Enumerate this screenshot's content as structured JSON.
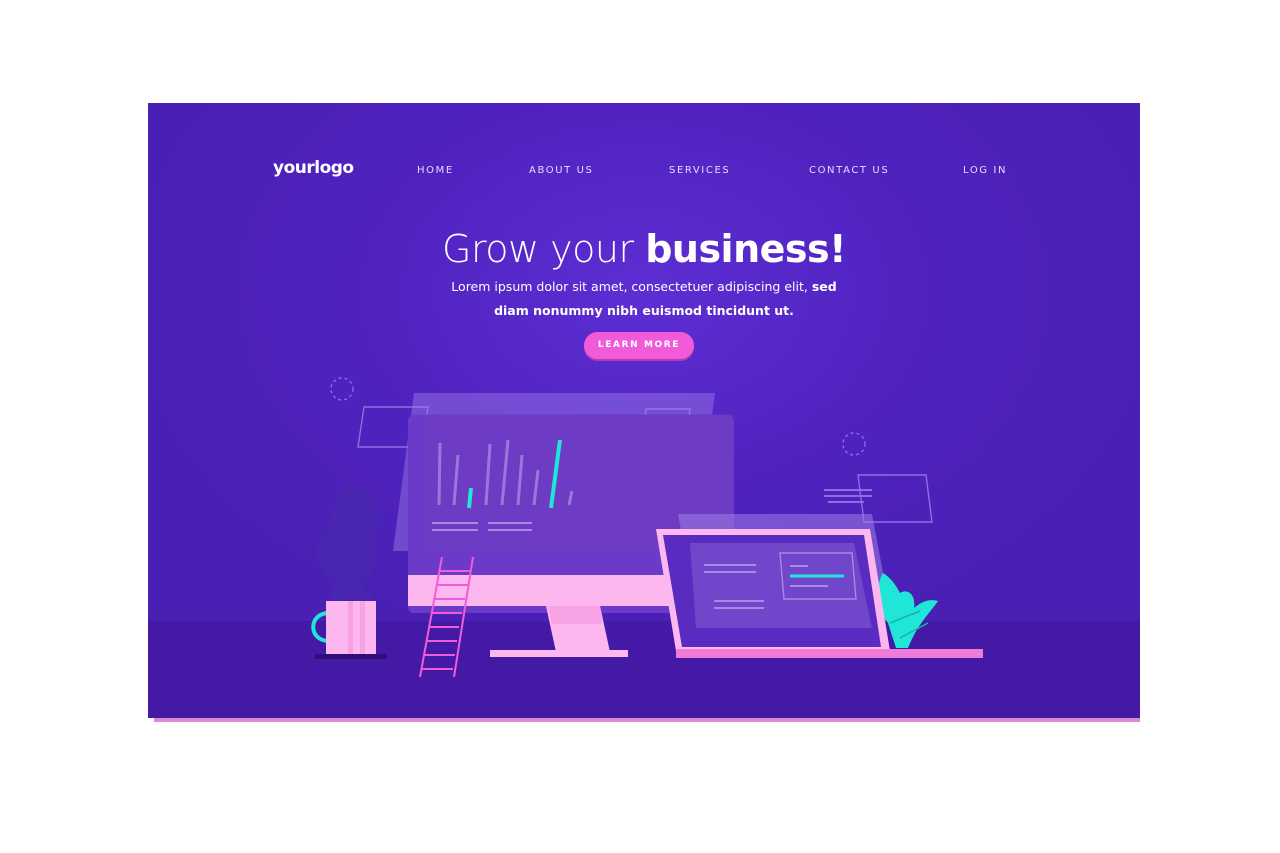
{
  "brand": {
    "logo": "yourlogo"
  },
  "nav": {
    "items": [
      "HOME",
      "ABOUT US",
      "SERVICES",
      "CONTACT US",
      "LOG IN"
    ]
  },
  "hero": {
    "headline_light": "Grow your ",
    "headline_bold": "business!",
    "subtitle_line1_regular": "Lorem ipsum dolor sit amet, consectetuer adipiscing elit, ",
    "subtitle_line1_bold": "sed",
    "subtitle_line2": "diam nonummy nibh euismod tincidunt ut.",
    "cta_label": "LEARN MORE"
  },
  "colors": {
    "background": "#5a2bcf",
    "accent_pink": "#f15bd9",
    "accent_cyan": "#1fe6d6",
    "device_pink": "#fbb7ee"
  },
  "icons": [
    "coffee-mug-icon",
    "ladder-icon",
    "plant-icon",
    "desktop-monitor-icon",
    "laptop-icon"
  ]
}
